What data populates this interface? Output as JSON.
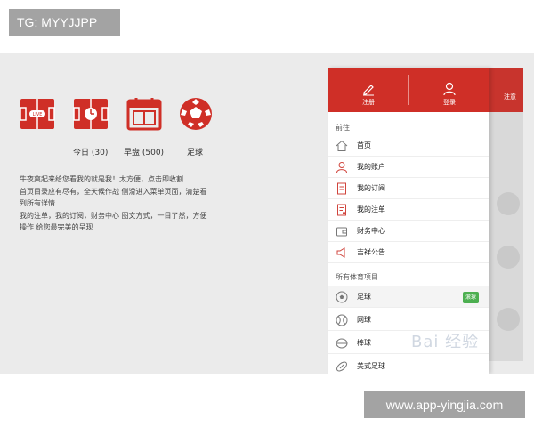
{
  "badges": {
    "tg": "TG: MYYJJPP",
    "url": "www.app-yingjia.com"
  },
  "icons": [
    {
      "name": "pitch-live-icon",
      "label": ""
    },
    {
      "name": "pitch-clock-icon",
      "label": "今日 (30)"
    },
    {
      "name": "calendar-icon",
      "label": "早盘 (500)"
    },
    {
      "name": "soccer-ball-icon",
      "label": "足球"
    }
  ],
  "pitch_badge": "LIVE",
  "description": {
    "line1": "牛夜爽起来给您看我的就是我！太方便，点击即收割",
    "line2": "首页目录应有尽有，全天候作战 侧滑进入菜单页面，清楚看",
    "line3": "到所有详情",
    "line4": "我的注单，我的订阅，财务中心 图文方式，一目了然，方便",
    "line5": "操作 给您最完美的呈现"
  },
  "drawer": {
    "register_label": "注册",
    "login_label": "登录",
    "section_goto": "前往",
    "menu": [
      {
        "icon": "home-icon",
        "label": "首页"
      },
      {
        "icon": "user-icon",
        "label": "我的账户"
      },
      {
        "icon": "document-icon",
        "label": "我的订阅"
      },
      {
        "icon": "edit-document-icon",
        "label": "我的注单"
      },
      {
        "icon": "wallet-icon",
        "label": "财务中心"
      },
      {
        "icon": "megaphone-icon",
        "label": "吉祥公告"
      }
    ],
    "section_sports": "所有体育项目",
    "sports": [
      {
        "icon": "soccer-ball-icon",
        "label": "足球",
        "badge": "滚球"
      },
      {
        "icon": "tennis-ball-icon",
        "label": "网球",
        "badge": ""
      },
      {
        "icon": "baseball-icon",
        "label": "棒球",
        "badge": ""
      },
      {
        "icon": "american-football-icon",
        "label": "美式足球",
        "badge": ""
      }
    ]
  },
  "background_app": {
    "header_text": "注意"
  },
  "watermark": "Bai 经验",
  "colors": {
    "brand_red": "#cf2f27",
    "badge_green": "#4caf50",
    "stage_gray": "#ebebeb",
    "badge_gray": "#a3a3a3"
  }
}
